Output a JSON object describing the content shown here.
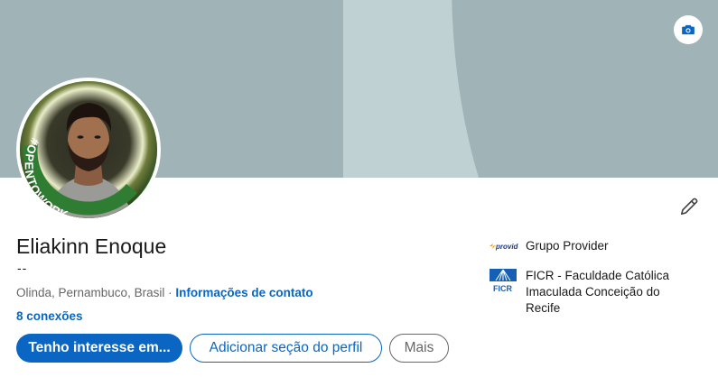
{
  "profile": {
    "name": "Eliakinn Enoque",
    "headline": "--",
    "location": "Olinda, Pernambuco, Brasil",
    "separator": " · ",
    "contact_info_link": "Informações de contato",
    "connections": "8 conexões",
    "open_to_work_badge": "#OPENTOWORK"
  },
  "actions": {
    "primary_label": "Tenho interesse em...",
    "add_section_label": "Adicionar seção do perfil",
    "more_label": "Mais"
  },
  "experience": [
    {
      "name": "Grupo Provider",
      "logo_text": "provider",
      "logo_icon": "provider-logo"
    },
    {
      "name": "FICR - Faculdade Católica Imaculada Conceição do Recife",
      "logo_text": "FICR",
      "logo_icon": "ficr-logo"
    }
  ],
  "icons": {
    "camera": "camera-icon",
    "edit": "pencil-icon"
  },
  "colors": {
    "accent": "#0a66c2",
    "banner_dark": "#a0b4b7",
    "banner_light": "#bfd1d3",
    "open_to_work": "#2e7d32"
  }
}
